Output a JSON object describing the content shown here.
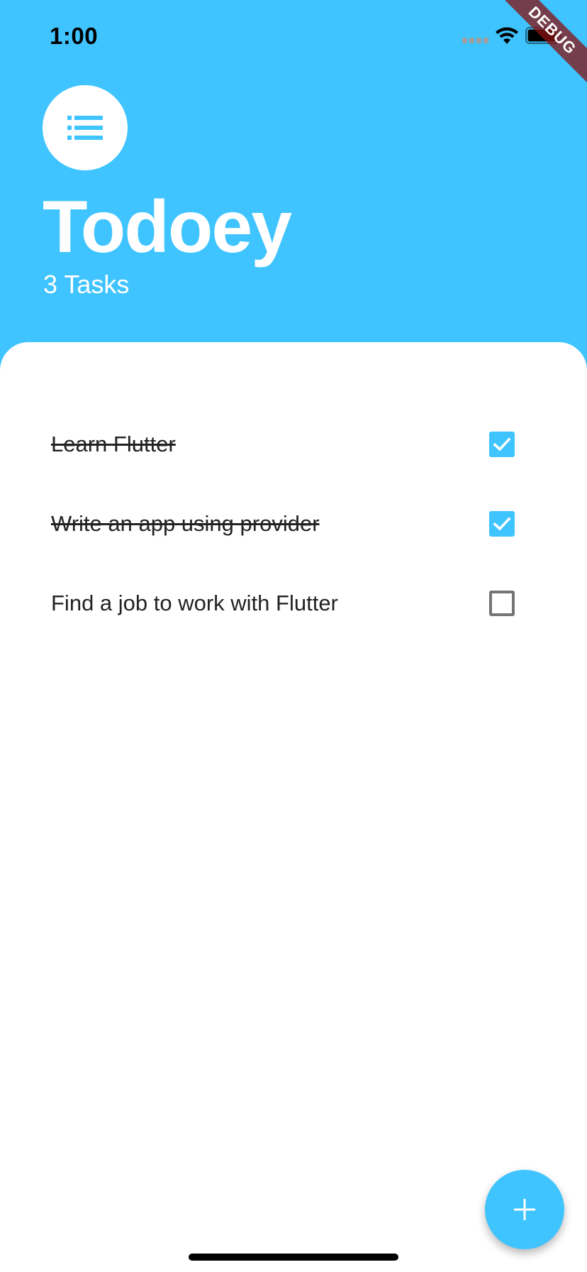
{
  "status_bar": {
    "time": "1:00",
    "icons": [
      "cellular-signal-icon",
      "wifi-icon",
      "battery-icon"
    ]
  },
  "debug_banner": "DEBUG",
  "header": {
    "icon": "list-icon",
    "title": "Todoey",
    "task_count": "3 Tasks"
  },
  "tasks": [
    {
      "label": "Learn Flutter",
      "done": true
    },
    {
      "label": "Write an app using provider",
      "done": true
    },
    {
      "label": "Find a job to work with Flutter",
      "done": false
    }
  ],
  "fab": {
    "icon": "plus-icon"
  },
  "colors": {
    "accent": "#40C4FF",
    "surface": "#FFFFFF",
    "text": "#222222",
    "checkbox_border": "#757575"
  }
}
